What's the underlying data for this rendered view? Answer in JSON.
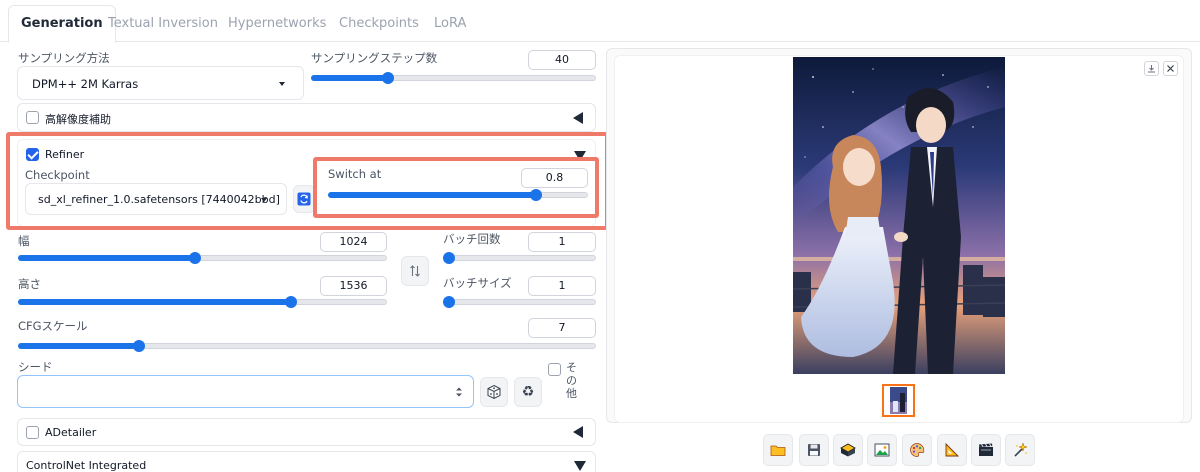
{
  "tabs": [
    "Generation",
    "Textual Inversion",
    "Hypernetworks",
    "Checkpoints",
    "LoRA"
  ],
  "sampler": {
    "method_label": "サンプリング方法",
    "method_value": "DPM++ 2M Karras",
    "steps_label": "サンプリングステップ数",
    "steps_value": "40",
    "steps_fraction": 0.27
  },
  "hires": {
    "label": "高解像度補助",
    "checked": false
  },
  "refiner": {
    "label": "Refiner",
    "checked": true,
    "checkpoint_label": "Checkpoint",
    "checkpoint_value": "sd_xl_refiner_1.0.safetensors [7440042bbd]",
    "switch_label": "Switch at",
    "switch_value": "0.8",
    "switch_fraction": 0.8
  },
  "width": {
    "label": "幅",
    "value": "1024",
    "fraction": 0.48
  },
  "height": {
    "label": "高さ",
    "value": "1536",
    "fraction": 0.74
  },
  "batch_count": {
    "label": "バッチ回数",
    "value": "1",
    "fraction": 0.0
  },
  "batch_size": {
    "label": "バッチサイズ",
    "value": "1",
    "fraction": 0.0
  },
  "cfg": {
    "label": "CFGスケール",
    "value": "7",
    "fraction": 0.21
  },
  "seed": {
    "label": "シード",
    "value": "",
    "extra_label": "その他"
  },
  "adetailer": {
    "label": "ADetailer",
    "checked": false
  },
  "controlnet": {
    "label": "ControlNet Integrated"
  },
  "gallery": {
    "icons": [
      "download-icon",
      "close-icon"
    ],
    "toolbar": [
      "folder-icon",
      "save-icon",
      "zip-icon",
      "image-icon",
      "palette-icon",
      "ruler-icon",
      "film-icon",
      "sparkle-icon"
    ]
  },
  "colors": {
    "accent": "#1a73e8",
    "highlight": "#f07a6a",
    "thumb_border": "#f97316"
  }
}
